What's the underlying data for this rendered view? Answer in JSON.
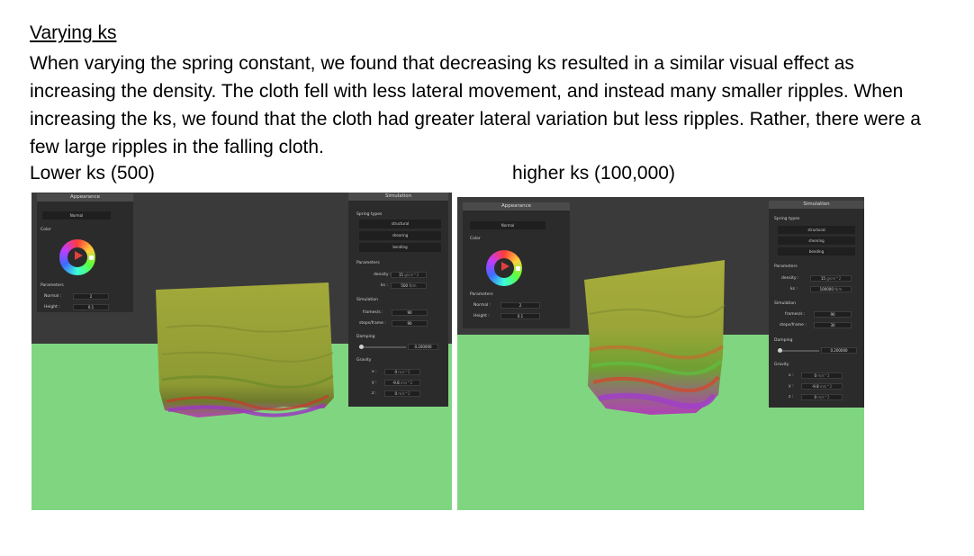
{
  "heading": "Varying ks",
  "paragraph": "When varying the spring constant, we found that decreasing ks resulted in a similar visual effect as increasing the density. The cloth fell with less lateral movement, and instead many smaller ripples. When increasing the ks, we found that the cloth had greater lateral variation but less ripples. Rather, there were a few large ripples in the falling cloth.",
  "captions": {
    "left": "Lower ks (500)",
    "right": "higher ks (100,000)"
  },
  "colors": {
    "floor": "#80d680",
    "background": "#3a3a3a",
    "panel": "#2b2b2b"
  },
  "shots": [
    {
      "appearance": {
        "title": "Appearance",
        "shader": "Normal",
        "color_label": "Color",
        "params_label": "Parameters",
        "normal_label": "Normal :",
        "normal_value": "2",
        "height_label": "Height :",
        "height_value": "0.1"
      },
      "simulation": {
        "title": "Simulation",
        "spring_types_label": "Spring types",
        "spring_types": [
          "structural",
          "shearing",
          "bending"
        ],
        "params_label": "Parameters",
        "density_label": "density :",
        "density_value": "15",
        "density_unit": "g/cm^2",
        "ks_label": "ks :",
        "ks_value": "500",
        "ks_unit": "N/m",
        "sim_label": "Simulation",
        "frames_label": "frames/s :",
        "frames_value": "90",
        "steps_label": "steps/frame :",
        "steps_value": "90",
        "damping_label": "Damping",
        "damping_value": "0.200000",
        "gravity_label": "Gravity",
        "gx_label": "x :",
        "gx_value": "0",
        "gy_label": "y :",
        "gy_value": "-9.8",
        "gz_label": "z :",
        "gz_value": "0",
        "g_unit": "m/s^2"
      }
    },
    {
      "appearance": {
        "title": "Appearance",
        "shader": "Normal",
        "color_label": "Color",
        "params_label": "Parameters",
        "normal_label": "Normal :",
        "normal_value": "2",
        "height_label": "Height :",
        "height_value": "0.1"
      },
      "simulation": {
        "title": "Simulation",
        "spring_types_label": "Spring types",
        "spring_types": [
          "structural",
          "shearing",
          "bending"
        ],
        "params_label": "Parameters",
        "density_label": "density :",
        "density_value": "15",
        "density_unit": "g/cm^2",
        "ks_label": "ks :",
        "ks_value": "100000",
        "ks_unit": "N/m",
        "sim_label": "Simulation",
        "frames_label": "frames/s :",
        "frames_value": "90",
        "steps_label": "steps/frame :",
        "steps_value": "30",
        "damping_label": "Damping",
        "damping_value": "0.200000",
        "gravity_label": "Gravity",
        "gx_label": "x :",
        "gx_value": "0",
        "gy_label": "y :",
        "gy_value": "-9.8",
        "gz_label": "z :",
        "gz_value": "0",
        "g_unit": "m/s^2"
      }
    }
  ]
}
